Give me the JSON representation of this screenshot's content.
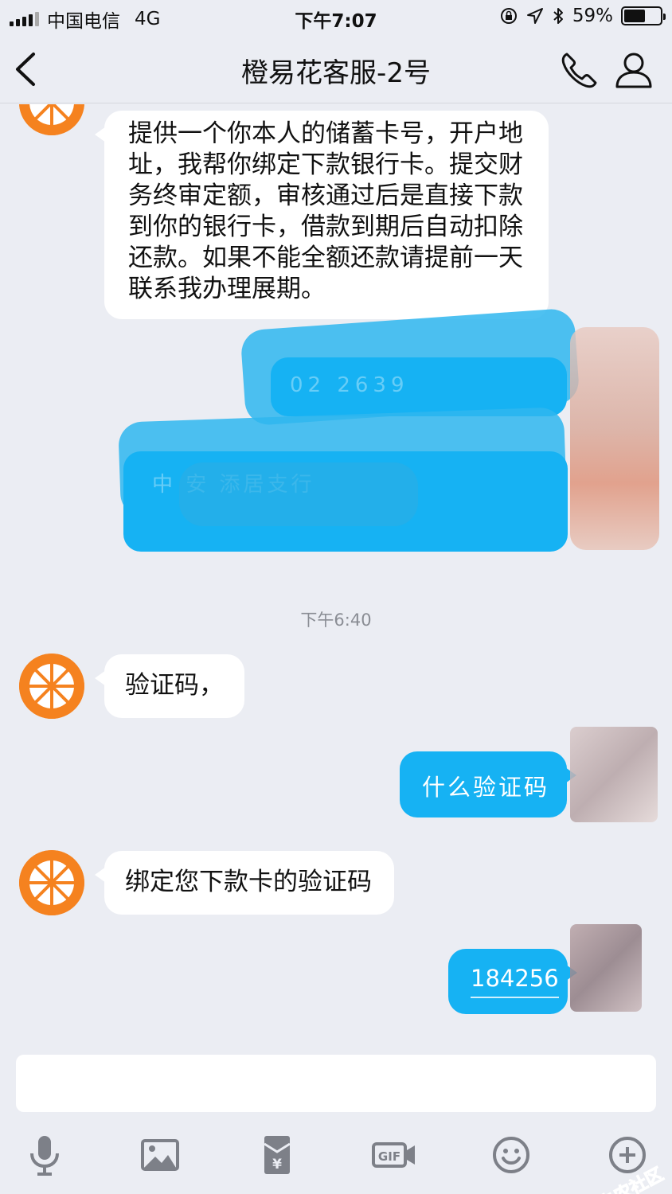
{
  "status_bar": {
    "carrier": "中国电信",
    "network": "4G",
    "time": "下午7:07",
    "battery_percent": "59%",
    "battery_level": 0.59
  },
  "nav": {
    "title": "橙易花客服-2号",
    "back_icon": "chevron-left-icon",
    "call_icon": "phone-icon",
    "profile_icon": "person-icon"
  },
  "messages": {
    "m1": "提供一个你本人的储蓄卡号，开户地址，我帮你绑定下款银行卡。提交财务终审定额，审核通过后是直接下款到你的银行卡，借款到期后自动扣除还款。如果不能全额还款请提前一天联系我办理展期。",
    "redacted_1_fragment": "02        2639",
    "redacted_2_fragment": "中         安    添居支行",
    "time_separator": "下午6:40",
    "m2": "验证码，",
    "m3": "什么验证码",
    "m4": "绑定您下款卡的验证码",
    "m5": "184256"
  },
  "input": {
    "placeholder": "",
    "value": ""
  },
  "toolbar": {
    "icons": [
      "microphone-icon",
      "image-icon",
      "red-packet-icon",
      "gif-icon",
      "emoji-icon",
      "plus-icon"
    ]
  },
  "watermark": {
    "text": "卡农社区"
  },
  "colors": {
    "background": "#ebedf3",
    "outgoing_bubble": "#16b2f3",
    "incoming_bubble": "#ffffff",
    "avatar": "#f5821f"
  }
}
